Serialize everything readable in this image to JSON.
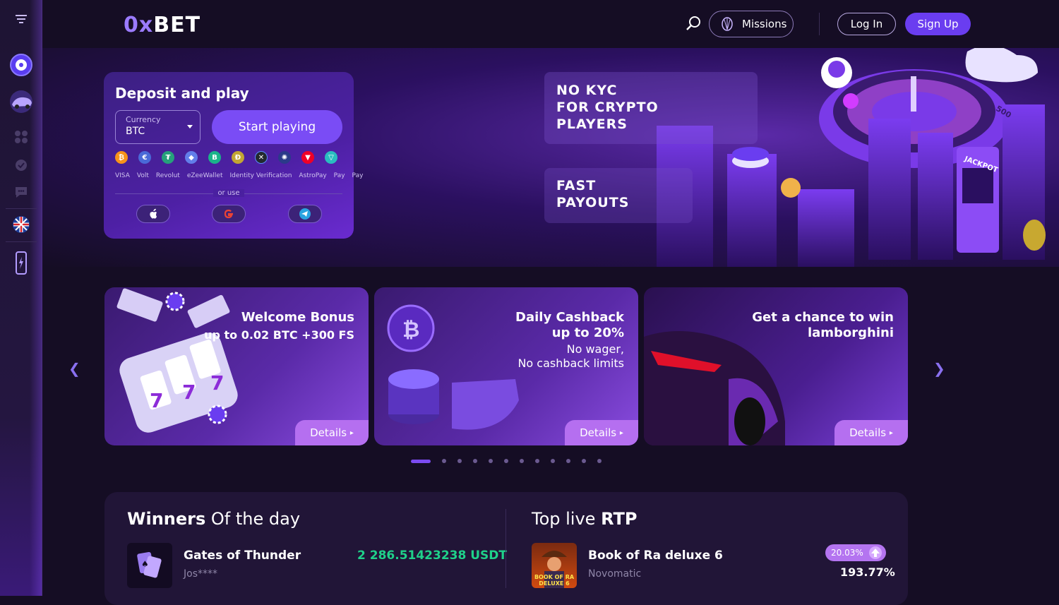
{
  "header": {
    "logo_text": "BET",
    "logo_prefix": "0x",
    "missions_label": "Missions",
    "login_label": "Log In",
    "signup_label": "Sign Up"
  },
  "deposit": {
    "title": "Deposit and play",
    "currency_label": "Currency",
    "currency_value": "BTC",
    "start_label": "Start playing",
    "or_use": "or use",
    "payments": [
      "VISA",
      "Volt",
      "Revolut",
      "eZeeWallet",
      "Identity Verification",
      "AstroPay",
      "Pay",
      "Pay"
    ]
  },
  "banner": {
    "line1": "NO KYC",
    "line2": "FOR CRYPTO",
    "line3": "PLAYERS",
    "line4": "FAST",
    "line5": "PAYOUTS",
    "jackpot": "JACKPOT",
    "note": "500"
  },
  "promos": [
    {
      "title": "Welcome Bonus",
      "sub": "up to 0.02 BTC +300 FS",
      "details": "Details"
    },
    {
      "title": "Daily Cashback",
      "title2": "up to 20%",
      "sub": "No wager,",
      "sub2": "No cashback limits",
      "details": "Details"
    },
    {
      "title": "Get a chance to win",
      "title2": "lamborghini",
      "details": "Details"
    }
  ],
  "winners": {
    "title_bold": "Winners",
    "title_rest": " Of the day",
    "game": "Gates of Thunder",
    "user": "Jos****",
    "amount": "2 286.51423238 USDT"
  },
  "rtp": {
    "title_rest": "Top live ",
    "title_bold": "RTP",
    "game": "Book of Ra deluxe 6",
    "provider": "Novomatic",
    "badge": "20.03%",
    "value": "193.77%",
    "thumb_text": "BOOK OF RA DELUXE 6"
  }
}
